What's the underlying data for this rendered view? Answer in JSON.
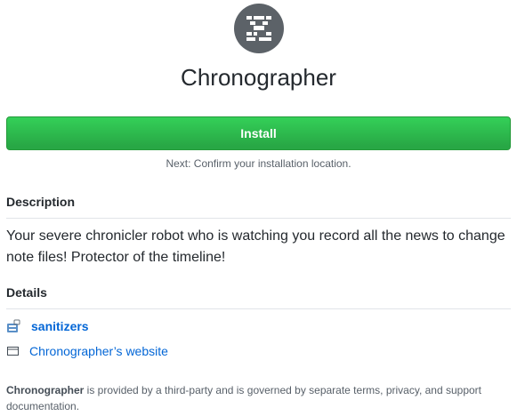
{
  "app": {
    "name": "Chronographer",
    "logo_icon": "robot-logo-icon",
    "logo_color": "#5c6268"
  },
  "install": {
    "button_label": "Install",
    "next_hint": "Next: Confirm your installation location.",
    "button_color": "#28a745"
  },
  "description": {
    "heading": "Description",
    "text": "Your severe chronicler robot who is watching you record all the news to change note files! Protector of the timeline!"
  },
  "details": {
    "heading": "Details",
    "owner": {
      "icon": "organization-avatar-icon",
      "label": "sanitizers"
    },
    "website": {
      "icon": "browser-window-icon",
      "label": "Chronographer’s website"
    },
    "link_color": "#0366d6"
  },
  "footer": {
    "app_name": "Chronographer",
    "text": " is provided by a third-party and is governed by separate terms, privacy, and support documentation."
  }
}
